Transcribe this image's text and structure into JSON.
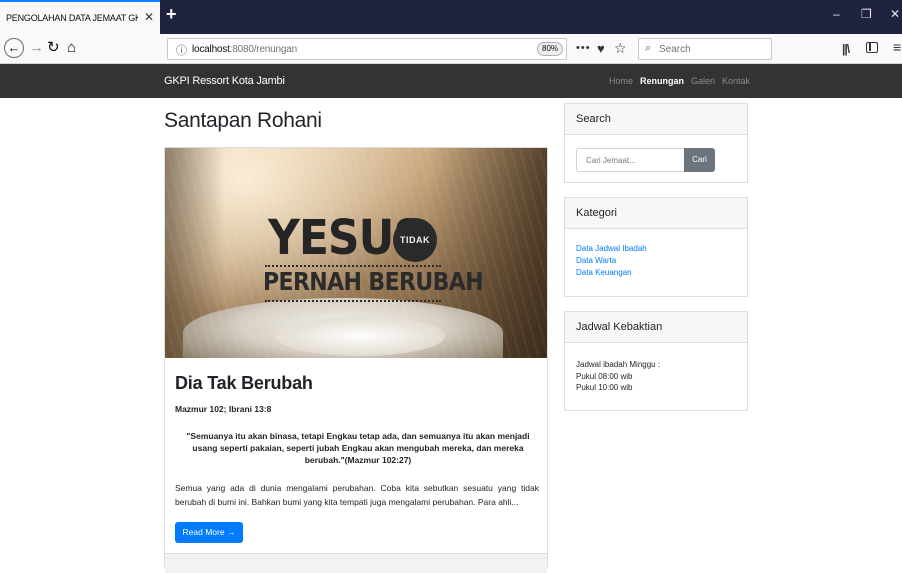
{
  "browser": {
    "tab_title": "PENGOLAHAN DATA JEMAAT GKPI",
    "tab_close": "✕",
    "new_tab": "+",
    "url_host": "localhost",
    "url_path": ":8080/renungan",
    "zoom": "80%",
    "page_actions": "•••",
    "search_placeholder": "Search",
    "controls": {
      "minimize": "–",
      "restore": "❐",
      "close": "✕"
    }
  },
  "site": {
    "brand": "GKPI Ressort Kota Jambi",
    "nav": [
      {
        "label": "Home",
        "active": false
      },
      {
        "label": "Renungan",
        "active": true
      },
      {
        "label": "Galeri",
        "active": false
      },
      {
        "label": "Kontak",
        "active": false
      }
    ]
  },
  "main": {
    "page_title": "Santapan Rohani",
    "hero": {
      "line1": "YESUS",
      "badge": "TIDAK",
      "line2": "PERNAH BERUBAH"
    },
    "post": {
      "title": "Dia Tak Berubah",
      "reference": "Mazmur 102; Ibrani 13:8",
      "quote": "\"Semuanya itu akan binasa, tetapi Engkau tetap ada, dan semuanya itu akan menjadi usang seperti pakaian, seperti jubah Engkau akan mengubah mereka, dan mereka berubah.\"(Mazmur 102:27)",
      "excerpt": "Semua yang ada di dunia mengalami perubahan. Coba kita sebutkan sesuatu yang tidak berubah di bumi ini. Bahkan bumi yang kita tempati juga mengalami perubahan. Para ahli...",
      "read_more": "Read More →"
    }
  },
  "sidebar": {
    "search": {
      "heading": "Search",
      "placeholder": "Cari Jemaat...",
      "button": "Cari"
    },
    "kategori": {
      "heading": "Kategori",
      "items": [
        "Data Jadwal Ibadah",
        "Data Warta",
        "Data Keuangan"
      ]
    },
    "jadwal": {
      "heading": "Jadwal Kebaktian",
      "lines": [
        "Jadwal ibadah Minggu :",
        "Pukul 08:00 wib",
        "Pukul 10:00 wib"
      ]
    }
  },
  "colors": {
    "accent": "#007bff",
    "navbar": "#333333",
    "browser_tabbar": "#202340"
  }
}
